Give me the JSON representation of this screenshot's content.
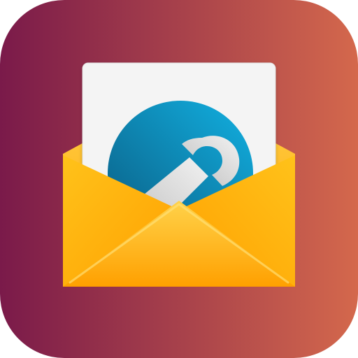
{
  "icon": {
    "subject": "mail-settings-app-icon",
    "symbols": [
      "envelope-icon",
      "letter-icon",
      "wrench-icon"
    ],
    "colors": {
      "tile_gradient_start": "#7A1A4A",
      "tile_gradient_end": "#D4684C",
      "paper": "#F4F4F4",
      "circle_light": "#12B1E2",
      "circle_dark": "#0A5A80",
      "wrench_light": "#F2F2F2",
      "wrench_dark": "#BDBDBD",
      "envelope_light": "#FFD24A",
      "envelope_mid": "#FFC21A",
      "envelope_dark": "#FFA000"
    }
  }
}
